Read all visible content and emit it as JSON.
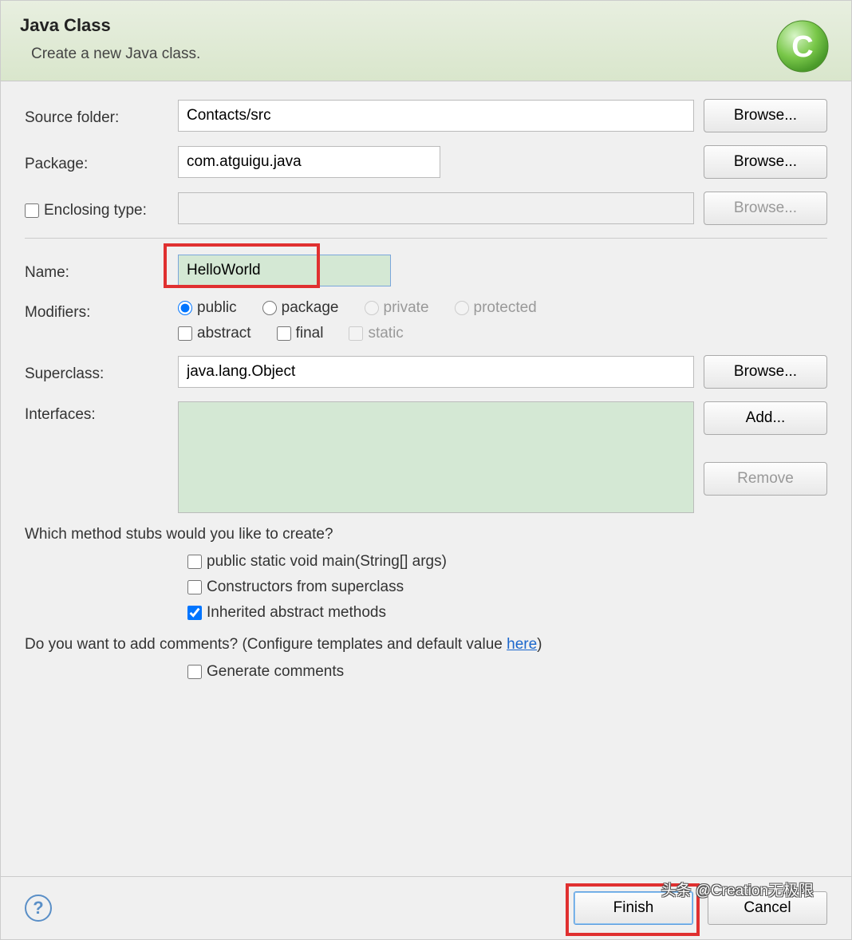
{
  "header": {
    "title": "Java Class",
    "subtitle": "Create a new Java class."
  },
  "labels": {
    "source_folder": "Source folder:",
    "package": "Package:",
    "enclosing_type": "Enclosing type:",
    "name": "Name:",
    "modifiers": "Modifiers:",
    "superclass": "Superclass:",
    "interfaces": "Interfaces:"
  },
  "values": {
    "source_folder": "Contacts/src",
    "package": "com.atguigu.java",
    "enclosing_type": "",
    "name": "HelloWorld",
    "superclass": "java.lang.Object",
    "interfaces": ""
  },
  "buttons": {
    "browse": "Browse...",
    "add": "Add...",
    "remove": "Remove",
    "finish": "Finish",
    "cancel": "Cancel"
  },
  "modifiers": {
    "radios": {
      "public": "public",
      "package": "package",
      "private": "private",
      "protected": "protected"
    },
    "checks": {
      "abstract": "abstract",
      "final": "final",
      "static": "static"
    }
  },
  "stubs": {
    "question": "Which method stubs would you like to create?",
    "main": "public static void main(String[] args)",
    "constructors": "Constructors from superclass",
    "inherited": "Inherited abstract methods"
  },
  "comments": {
    "question_prefix": "Do you want to add comments? (Configure templates and default value ",
    "link": "here",
    "question_suffix": ")",
    "generate": "Generate comments"
  },
  "watermark": "头条 @Creation无极限"
}
